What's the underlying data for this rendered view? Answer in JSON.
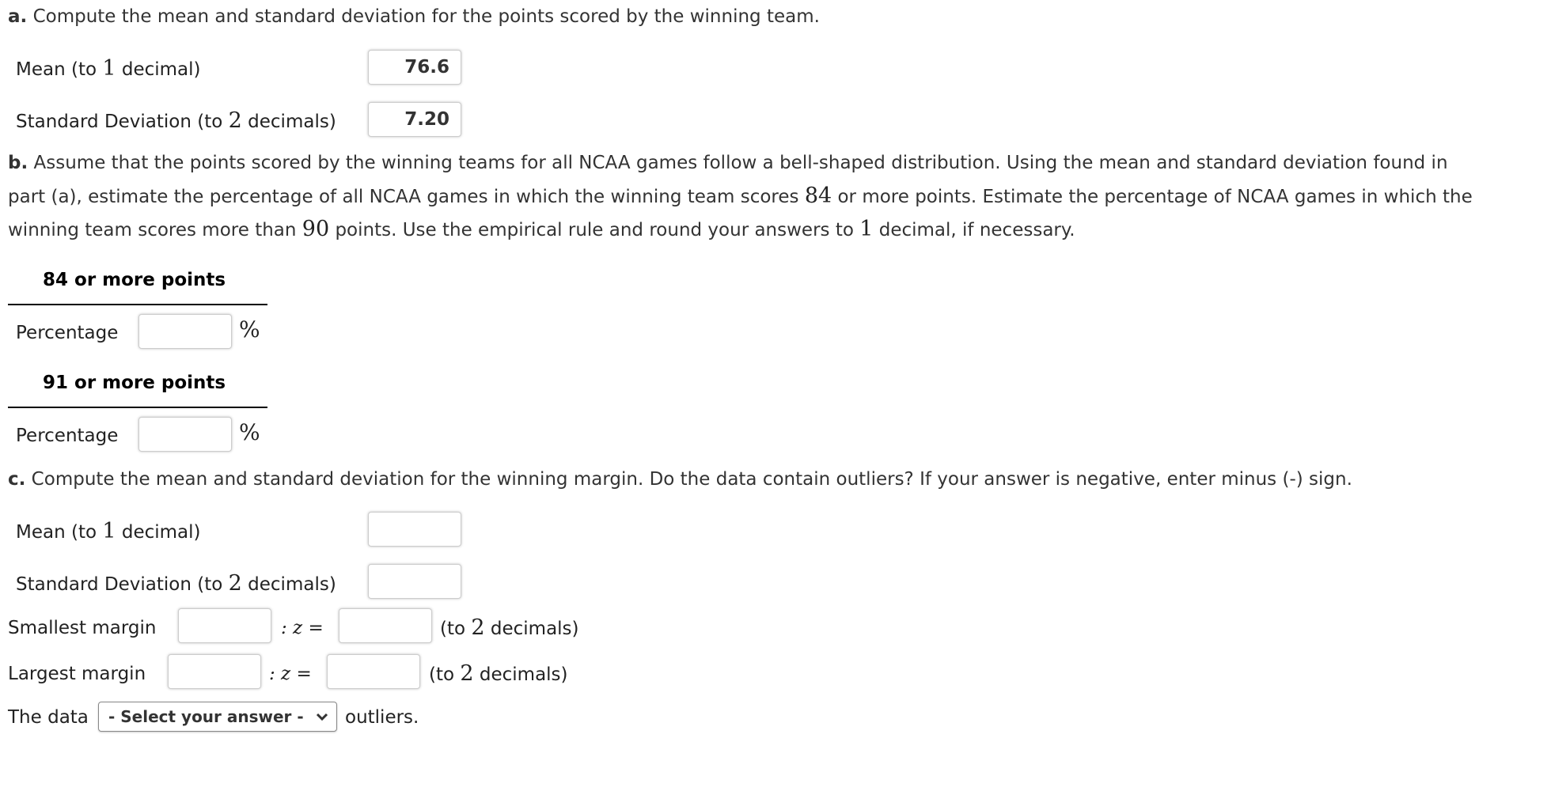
{
  "part_a": {
    "label": "a.",
    "prompt": " Compute the mean and standard deviation for the points scored by the winning team.",
    "mean_label_pre": "Mean (to ",
    "mean_label_num": "1",
    "mean_label_post": " decimal)",
    "mean_value": "76.6",
    "sd_label_pre": "Standard Deviation (to ",
    "sd_label_num": "2",
    "sd_label_post": " decimals)",
    "sd_value": "7.20"
  },
  "part_b": {
    "label": "b.",
    "line1": " Assume that the points scored by the winning teams for all NCAA games follow a bell-shaped distribution. Using the mean and standard deviation found in",
    "line2_pre": "part (a), estimate the percentage of all NCAA games in which the winning team scores ",
    "line2_num": "84",
    "line2_post": " or more points. Estimate the percentage of NCAA games in which the",
    "line3_pre": "winning team scores more than ",
    "line3_num": "90",
    "line3_mid": " points. Use the empirical rule and round your answers to ",
    "line3_num2": "1",
    "line3_post": " decimal, if necessary.",
    "group1_header": "84 or more points",
    "group1_label": "Percentage",
    "group1_value": "",
    "group2_header": "91 or more points",
    "group2_label": "Percentage",
    "group2_value": "",
    "percent_sign": "%"
  },
  "part_c": {
    "label": "c.",
    "prompt": " Compute the mean and standard deviation for the winning margin. Do the data contain outliers? If your answer is negative, enter minus (-) sign.",
    "mean_label_pre": "Mean (to ",
    "mean_label_num": "1",
    "mean_label_post": " decimal)",
    "mean_value": "",
    "sd_label_pre": "Standard Deviation (to ",
    "sd_label_num": "2",
    "sd_label_post": " decimals)",
    "sd_value": "",
    "smallest_label": "Smallest margin",
    "smallest_value": "",
    "smallest_z": "",
    "largest_label": "Largest margin",
    "largest_value": "",
    "largest_z": "",
    "z_label": ": z =",
    "decimals_pre": "(to ",
    "decimals_num": "2",
    "decimals_post": " decimals)",
    "data_label": "The data",
    "select_value": "- Select your answer -",
    "select_icon": "chevron-down-icon",
    "outliers_label": "outliers."
  }
}
